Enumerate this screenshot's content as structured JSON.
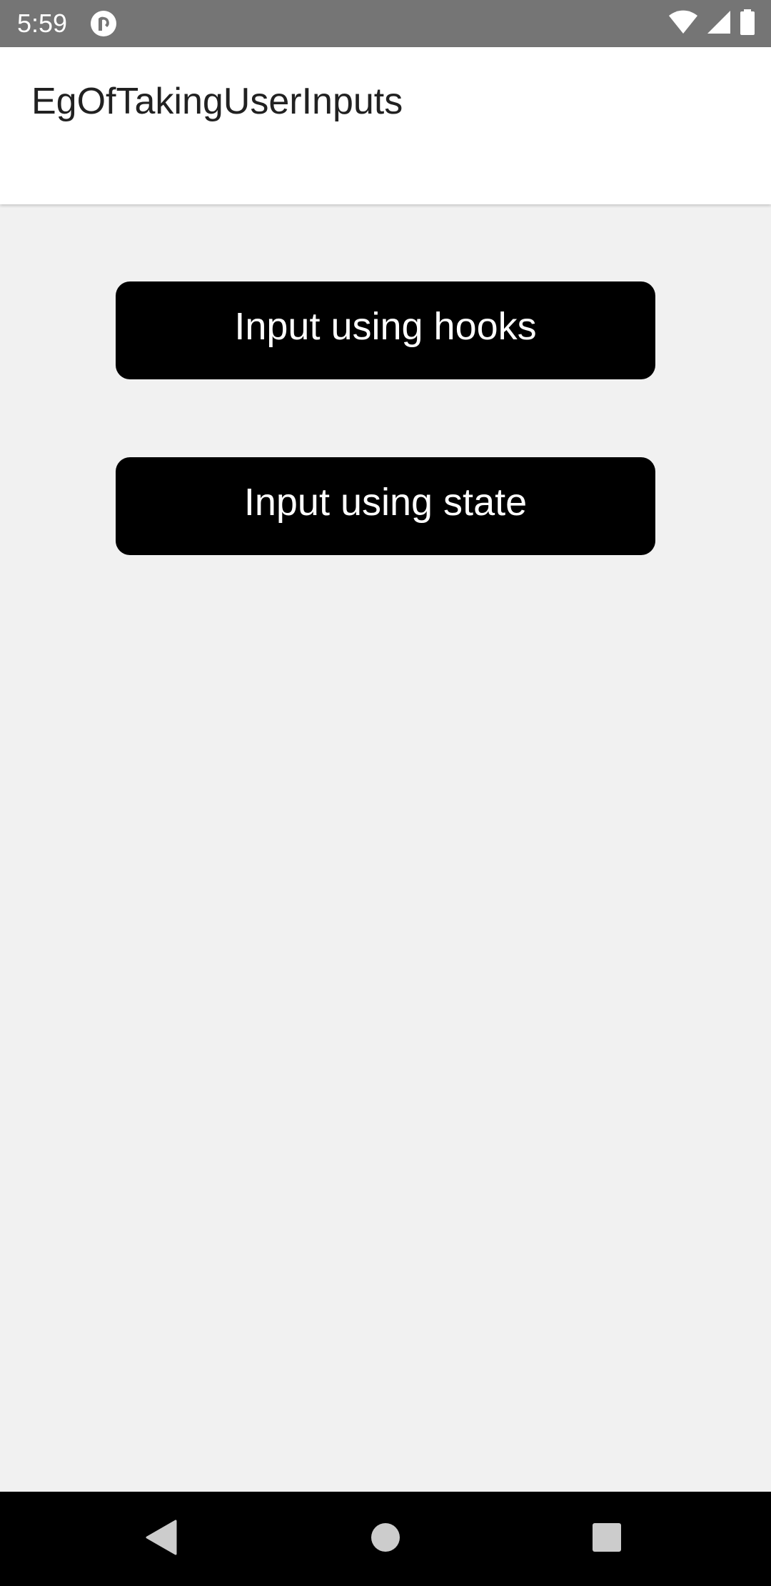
{
  "status_bar": {
    "time": "5:59",
    "app_icon": "pocket-casts-icon",
    "icons": [
      "wifi-icon",
      "cellular-signal-icon",
      "battery-icon"
    ]
  },
  "app_bar": {
    "title": "EgOfTakingUserInputs"
  },
  "buttons": [
    {
      "label": "Input using hooks"
    },
    {
      "label": "Input using state"
    }
  ],
  "nav_bar": {
    "icons": [
      "back-icon",
      "home-icon",
      "recents-icon"
    ]
  },
  "colors": {
    "status_bar_bg": "#757575",
    "app_bar_bg": "#ffffff",
    "content_bg": "#f1f1f1",
    "button_bg": "#000000",
    "button_text": "#ffffff",
    "nav_bar_bg": "#000000"
  }
}
